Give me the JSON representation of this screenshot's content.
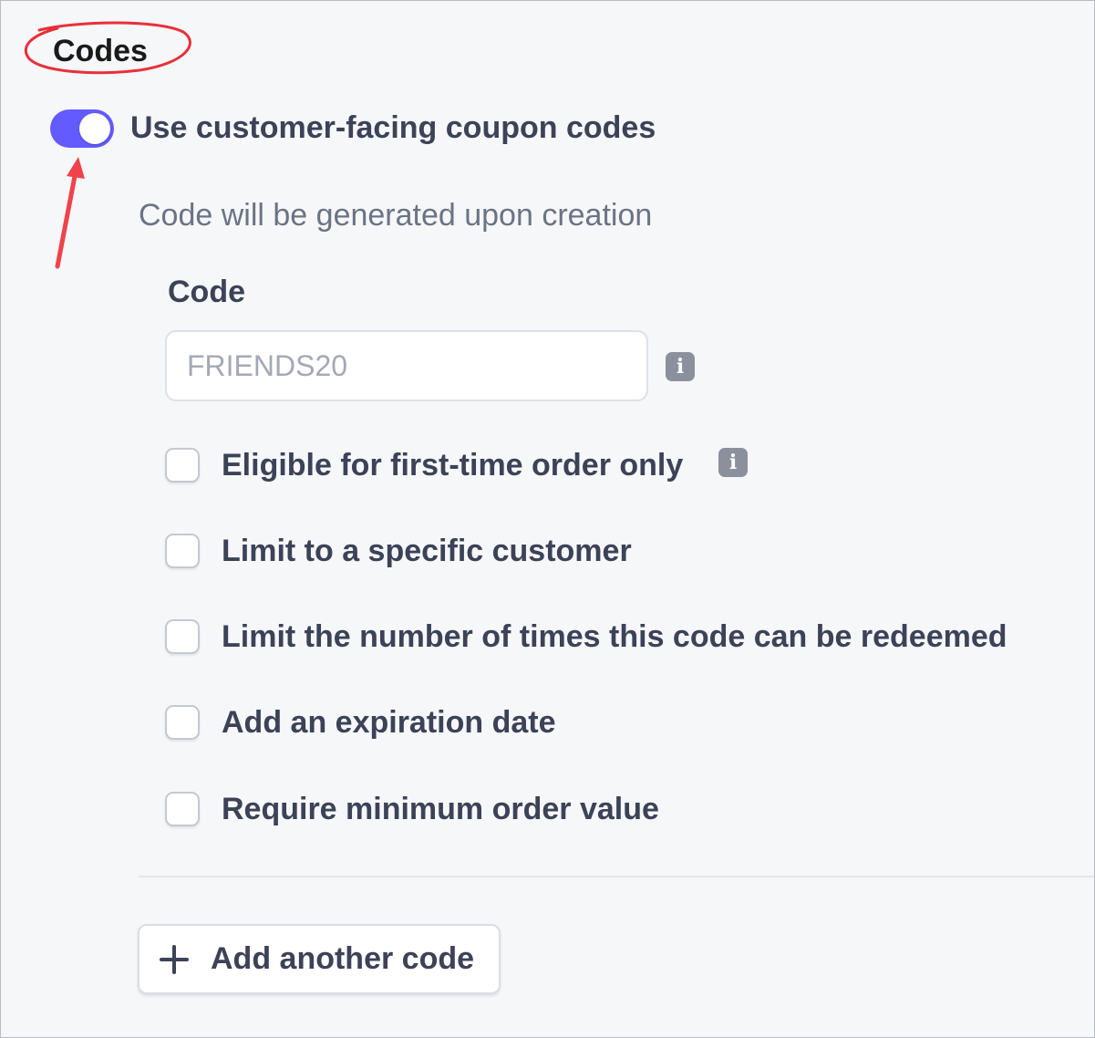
{
  "section": {
    "title": "Codes"
  },
  "toggle": {
    "label": "Use customer-facing coupon codes",
    "enabled": true,
    "color": "#635bff"
  },
  "helper_text": "Code will be generated upon creation",
  "code_field": {
    "label": "Code",
    "value": "",
    "placeholder": "FRIENDS20",
    "info_icon": "info-icon"
  },
  "options": [
    {
      "label": "Eligible for first-time order only",
      "checked": false,
      "info_icon": "info-icon"
    },
    {
      "label": "Limit to a specific customer",
      "checked": false
    },
    {
      "label": "Limit the number of times this code can be redeemed",
      "checked": false
    },
    {
      "label": "Add an expiration date",
      "checked": false
    },
    {
      "label": "Require minimum order value",
      "checked": false
    }
  ],
  "add_button": {
    "label": "Add another code",
    "icon": "plus-icon"
  },
  "annotations": {
    "circle_color": "#e8303a",
    "arrow_color": "#f0424a"
  }
}
